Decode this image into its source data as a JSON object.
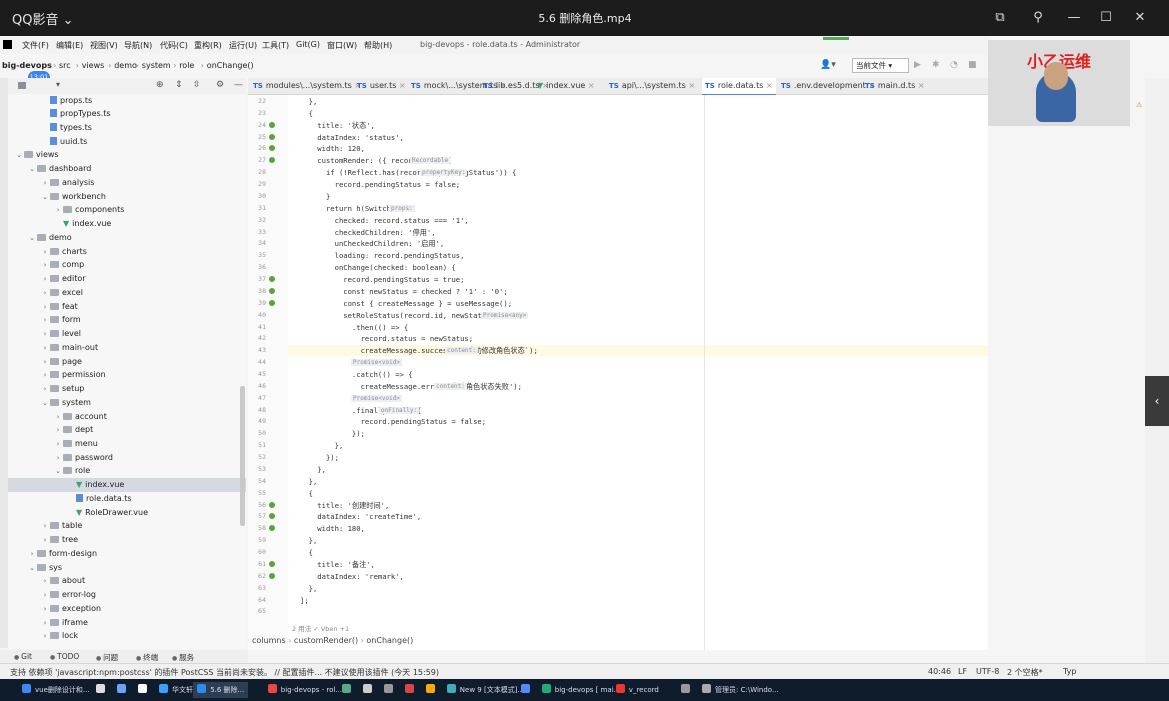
{
  "player": {
    "logo": "QQ影音",
    "title": "5.6 删除角色.mp4"
  },
  "ide": {
    "menu": [
      "文件(F)",
      "编辑(E)",
      "视图(V)",
      "导航(N)",
      "代码(C)",
      "重构(R)",
      "运行(U)",
      "工具(T)",
      "Git(G)",
      "窗口(W)",
      "帮助(H)"
    ],
    "project_title": "big-devops - role.data.ts - Administrator",
    "breadcrumbs": [
      "big-devops",
      "src",
      "views",
      "demo",
      "system",
      "role",
      "onChange()"
    ],
    "badge": "13:01",
    "branch": "当前文件",
    "tabs": [
      {
        "label": "modules\\...\\system.ts",
        "type": "ts"
      },
      {
        "label": "user.ts",
        "type": "ts"
      },
      {
        "label": "mock\\...\\system.ts",
        "type": "ts"
      },
      {
        "label": "lib.es5.d.ts",
        "type": "ts"
      },
      {
        "label": "index.vue",
        "type": "vue"
      },
      {
        "label": "api\\...\\system.ts",
        "type": "ts"
      },
      {
        "label": "role.data.ts",
        "type": "ts",
        "active": true
      },
      {
        "label": ".env.development",
        "type": "ts"
      },
      {
        "label": "main.d.ts",
        "type": "ts"
      }
    ],
    "tree": [
      {
        "label": "props.ts",
        "depth": 4,
        "kind": "ts"
      },
      {
        "label": "propTypes.ts",
        "depth": 4,
        "kind": "ts"
      },
      {
        "label": "types.ts",
        "depth": 4,
        "kind": "ts"
      },
      {
        "label": "uuid.ts",
        "depth": 4,
        "kind": "ts"
      },
      {
        "label": "views",
        "depth": 2,
        "kind": "folder",
        "open": true
      },
      {
        "label": "dashboard",
        "depth": 3,
        "kind": "folder",
        "open": true
      },
      {
        "label": "analysis",
        "depth": 4,
        "kind": "folder"
      },
      {
        "label": "workbench",
        "depth": 4,
        "kind": "folder",
        "open": true
      },
      {
        "label": "components",
        "depth": 5,
        "kind": "folder"
      },
      {
        "label": "index.vue",
        "depth": 5,
        "kind": "vue"
      },
      {
        "label": "demo",
        "depth": 3,
        "kind": "folder",
        "open": true
      },
      {
        "label": "charts",
        "depth": 4,
        "kind": "folder"
      },
      {
        "label": "comp",
        "depth": 4,
        "kind": "folder"
      },
      {
        "label": "editor",
        "depth": 4,
        "kind": "folder"
      },
      {
        "label": "excel",
        "depth": 4,
        "kind": "folder"
      },
      {
        "label": "feat",
        "depth": 4,
        "kind": "folder"
      },
      {
        "label": "form",
        "depth": 4,
        "kind": "folder"
      },
      {
        "label": "level",
        "depth": 4,
        "kind": "folder"
      },
      {
        "label": "main-out",
        "depth": 4,
        "kind": "folder"
      },
      {
        "label": "page",
        "depth": 4,
        "kind": "folder"
      },
      {
        "label": "permission",
        "depth": 4,
        "kind": "folder"
      },
      {
        "label": "setup",
        "depth": 4,
        "kind": "folder"
      },
      {
        "label": "system",
        "depth": 4,
        "kind": "folder",
        "open": true
      },
      {
        "label": "account",
        "depth": 5,
        "kind": "folder"
      },
      {
        "label": "dept",
        "depth": 5,
        "kind": "folder"
      },
      {
        "label": "menu",
        "depth": 5,
        "kind": "folder"
      },
      {
        "label": "password",
        "depth": 5,
        "kind": "folder"
      },
      {
        "label": "role",
        "depth": 5,
        "kind": "folder",
        "open": true
      },
      {
        "label": "index.vue",
        "depth": 6,
        "kind": "vue",
        "selected": true
      },
      {
        "label": "role.data.ts",
        "depth": 6,
        "kind": "ts"
      },
      {
        "label": "RoleDrawer.vue",
        "depth": 6,
        "kind": "vue"
      },
      {
        "label": "table",
        "depth": 4,
        "kind": "folder"
      },
      {
        "label": "tree",
        "depth": 4,
        "kind": "folder"
      },
      {
        "label": "form-design",
        "depth": 3,
        "kind": "folder"
      },
      {
        "label": "sys",
        "depth": 3,
        "kind": "folder",
        "open": true
      },
      {
        "label": "about",
        "depth": 4,
        "kind": "folder"
      },
      {
        "label": "error-log",
        "depth": 4,
        "kind": "folder"
      },
      {
        "label": "exception",
        "depth": 4,
        "kind": "folder"
      },
      {
        "label": "iframe",
        "depth": 4,
        "kind": "folder"
      },
      {
        "label": "lock",
        "depth": 4,
        "kind": "folder"
      }
    ],
    "code_start_line": 22,
    "code_lines": [
      "  },",
      "  {",
      "    title: '状态',",
      "    dataIndex: 'status',",
      "    width: 120,",
      "    customRender: ({ record }) => {",
      "      if (!Reflect.has(record, 'pendingStatus')) {",
      "        record.pendingStatus = false;",
      "      }",
      "      return h(Switch, {",
      "        checked: record.status === '1',",
      "        checkedChildren: '停用',",
      "        unCheckedChildren: '启用',",
      "        loading: record.pendingStatus,",
      "        onChange(checked: boolean) {",
      "          record.pendingStatus = true;",
      "          const newStatus = checked ? '1' : '0';",
      "          const { createMessage } = useMessage();",
      "          setRoleStatus(record.id, newStatus)",
      "            .then(() => {",
      "              record.status = newStatus;",
      "              createMessage.success(`已成功修改角色状态`);",
      "            })",
      "            .catch(() => {",
      "              createMessage.error('修改角色状态失败');",
      "            })",
      "            .finally(() => {",
      "              record.pendingStatus = false;",
      "            });",
      "        },",
      "      });",
      "    },",
      "  },",
      "  {",
      "    title: '创建时间',",
      "    dataIndex: 'createTime',",
      "    width: 180,",
      "  },",
      "  {",
      "    title: '备注',",
      "    dataIndex: 'remark',",
      "  },",
      "];",
      ""
    ],
    "hints": {
      "record_type": "Recordable",
      "prop_key": "propertyKey:",
      "props": "props:",
      "promise_any": "Promise<any>",
      "content": "content:",
      "promise_void": "Promise<void>",
      "on_finally": "onFinally:"
    },
    "editor_footer": "2 用法   ✓ Vben +1",
    "code_breadcrumb": [
      "columns",
      "customRender()",
      "onChange()"
    ],
    "bottom_tabs": [
      "Git",
      "TODO",
      "问题",
      "终端",
      "服务"
    ],
    "status_message": "支持 依赖项 'javascript:npm:postcss' 的插件 PostCSS 当前尚未安装。 // 配置插件...   不建议使用该插件 (今天 15:59)",
    "status_position": "40:46",
    "status_eol": "LF",
    "status_encoding": "UTF-8",
    "status_indent": "2 个空格*",
    "status_lang": "Typ"
  },
  "webcam": {
    "title": "小乙运维"
  },
  "taskbar": [
    "vue删除设计和...",
    "",
    "",
    "",
    "华文轩",
    "5.6 删除...",
    "big-devops - rol...",
    "",
    "",
    "",
    "",
    "",
    "New 9 [文本模式]...",
    "",
    "big-devops [ mai...",
    "v_record",
    "",
    "管理员: C:\\Windo..."
  ]
}
